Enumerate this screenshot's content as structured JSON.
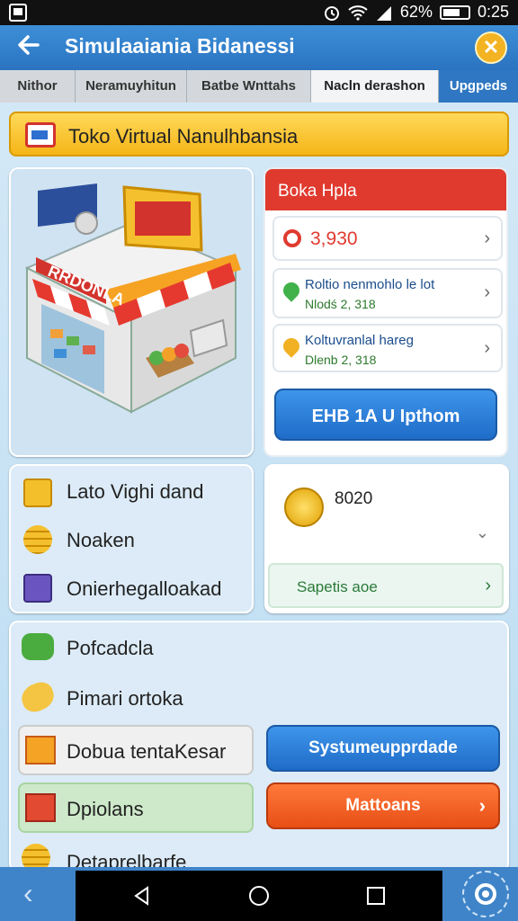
{
  "status": {
    "battery": "62%",
    "time": "0:25"
  },
  "header": {
    "title": "Simulaaiania Bidanessi"
  },
  "tabs": [
    {
      "label": "Nithor"
    },
    {
      "label": "Neramuyhitun"
    },
    {
      "label": "Batbe Wnttahs"
    },
    {
      "label": "Nacln derashon"
    },
    {
      "label": "Upgpeds"
    }
  ],
  "banner": {
    "text": "Toko Virtual Nanulhbansia"
  },
  "store": {
    "sign": "RRDONLA"
  },
  "panel": {
    "title": "Boka Hpla",
    "amount": "3,930",
    "item1": {
      "title": "Roltio nenmohlo le lot",
      "sub": "Nlodś 2, 318"
    },
    "item2": {
      "title": "Koltuvranlal hareg",
      "sub": "Dlenb 2, 318"
    },
    "button": "EHB 1A U Ipthom"
  },
  "left_list": [
    {
      "label": "Lato Vighi dand",
      "icon": "chat-icon"
    },
    {
      "label": "Noaken",
      "icon": "coins-icon"
    },
    {
      "label": "Onierhegalloakad",
      "icon": "register-icon"
    }
  ],
  "coin_card": {
    "value": "8020",
    "action": "Sapetis aoe"
  },
  "bottom_list": [
    {
      "label": "Pofcadcla",
      "icon": "puzzle-icon"
    },
    {
      "label": "Pimari ortoka",
      "icon": "bread-icon"
    },
    {
      "label": "Dobua tentaKesar",
      "icon": "box-icon"
    },
    {
      "label": "Dpiolans",
      "icon": "chest-icon"
    },
    {
      "label": "Detaprelbarfe",
      "icon": "coins-icon"
    }
  ],
  "buttons": {
    "upgrade": "Systumeupprdade",
    "matters": "Mattoans"
  },
  "colors": {
    "header": "#2f77c2",
    "accent_yellow": "#f5b517",
    "panel_red": "#e03a2f",
    "button_blue": "#1f79d8",
    "button_orange": "#f0541c"
  }
}
